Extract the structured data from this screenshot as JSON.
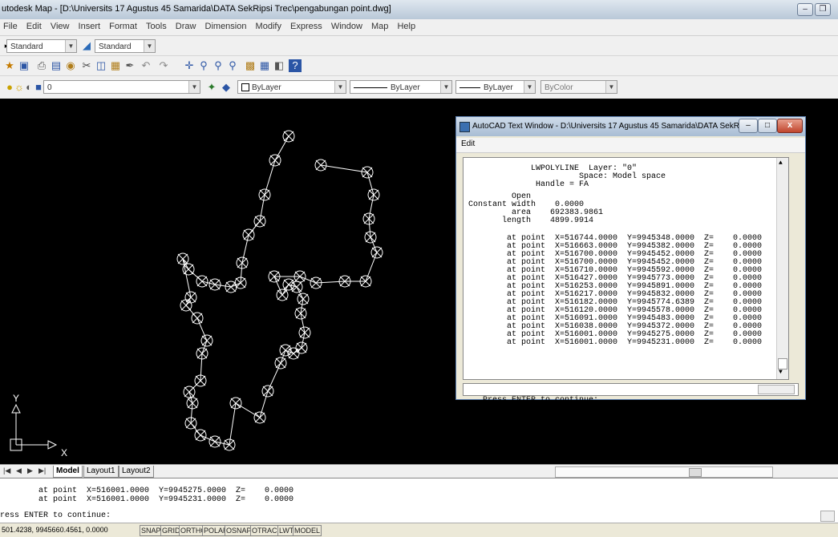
{
  "app": {
    "title": "utodesk Map - [D:\\Universits 17 Agustus 45 Samarida\\DATA SekRipsi Trec\\pengabungan point.dwg]"
  },
  "menu": [
    "File",
    "Edit",
    "View",
    "Insert",
    "Format",
    "Tools",
    "Draw",
    "Dimension",
    "Modify",
    "Express",
    "Window",
    "Map",
    "Help"
  ],
  "toolbar1": {
    "text_style": "Standard",
    "dim_style": "Standard"
  },
  "layer_toolbar": {
    "layer": "0",
    "color": "ByLayer",
    "linetype": "ByLayer",
    "lineweight": "ByLayer",
    "plotstyle": "ByColor"
  },
  "ucs": {
    "y_label": "Y",
    "x_label": "X"
  },
  "tabs": {
    "model": "Model",
    "layout1": "Layout1",
    "layout2": "Layout2"
  },
  "command_area": {
    "lines": [
      "        at point  X=516001.0000  Y=9945275.0000  Z=    0.0000",
      "        at point  X=516001.0000  Y=9945231.0000  Z=    0.0000"
    ],
    "prompt": "ress ENTER to continue:"
  },
  "status": {
    "coords": "501.4238, 9945660.4561, 0.0000",
    "buttons": [
      "SNAP",
      "GRID",
      "ORTHO",
      "POLAR",
      "OSNAP",
      "OTRACK",
      "LWT",
      "MODEL"
    ]
  },
  "text_window": {
    "title": "AutoCAD Text Window - D:\\Universits 17 Agustus 45 Samarida\\DATA SekR...",
    "menu_edit": "Edit",
    "header": [
      "              LWPOLYLINE  Layer: \"0\"",
      "                        Space: Model space",
      "               Handle = FA",
      "          Open",
      " Constant width    0.0000",
      "          area    692383.9861",
      "        length    4899.9914"
    ],
    "points": [
      "         at point  X=516744.0000  Y=9945348.0000  Z=    0.0000",
      "         at point  X=516663.0000  Y=9945382.0000  Z=    0.0000",
      "         at point  X=516700.0000  Y=9945452.0000  Z=    0.0000",
      "         at point  X=516700.0000  Y=9945452.0000  Z=    0.0000",
      "         at point  X=516710.0000  Y=9945592.0000  Z=    0.0000",
      "         at point  X=516427.0000  Y=9945773.0000  Z=    0.0000",
      "         at point  X=516253.0000  Y=9945891.0000  Z=    0.0000",
      "         at point  X=516217.0000  Y=9945832.0000  Z=    0.0000",
      "         at point  X=516182.0000  Y=9945774.6389  Z=    0.0000",
      "         at point  X=516120.0000  Y=9945578.0000  Z=    0.0000",
      "         at point  X=516091.0000  Y=9945483.0000  Z=    0.0000",
      "         at point  X=516038.0000  Y=9945372.0000  Z=    0.0000",
      "         at point  X=516001.0000  Y=9945275.0000  Z=    0.0000",
      "         at point  X=516001.0000  Y=9945231.0000  Z=    0.0000"
    ],
    "prompt": "Press ENTER to continue:"
  },
  "colors": {
    "drawing_bg": "#000000",
    "polyline": "#ffffff"
  }
}
